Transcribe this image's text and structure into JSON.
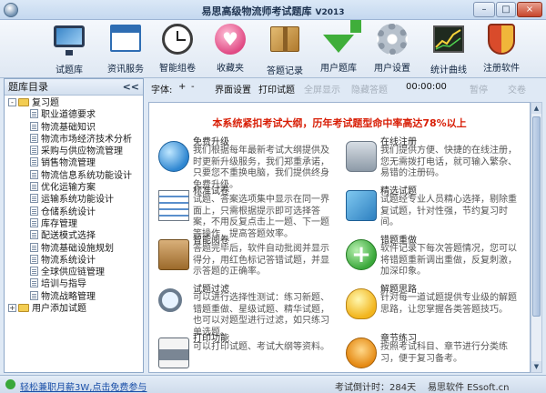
{
  "window": {
    "title": "易思高级物流师考试题库",
    "version": "V2013",
    "minimize": "–",
    "maximize": "□",
    "close": "×"
  },
  "toolbar": [
    {
      "label": "试题库",
      "icon": "monitor-icon"
    },
    {
      "label": "资讯服务",
      "icon": "webpage-icon"
    },
    {
      "label": "智能组卷",
      "icon": "clock-icon"
    },
    {
      "label": "收藏夹",
      "icon": "heart-icon"
    },
    {
      "label": "答题记录",
      "icon": "box-icon"
    },
    {
      "label": "用户题库",
      "icon": "download-arrow-icon"
    },
    {
      "label": "用户设置",
      "icon": "gear-icon"
    },
    {
      "label": "统计曲线",
      "icon": "line-chart-icon"
    },
    {
      "label": "注册软件",
      "icon": "shield-icon"
    }
  ],
  "sidebar": {
    "title": "题库目录",
    "collapse": "<<",
    "root": {
      "toggle": "-",
      "label": "复习题"
    },
    "items": [
      "职业道德要求",
      "物流基础知识",
      "物流市场经济技术分析",
      "采购与供应物流管理",
      "销售物流管理",
      "物流信息系统功能设计",
      "优化运输方案",
      "运输系统功能设计",
      "仓储系统设计",
      "库存管理",
      "配送模式选择",
      "物流基础设施规划",
      "物流系统设计",
      "全球供应链管理",
      "培训与指导",
      "物流战略管理"
    ],
    "user_root": {
      "toggle": "+",
      "label": "用户添加试题"
    }
  },
  "subbar": {
    "font_label": "字体:",
    "font_plus": "+",
    "font_minus": "-",
    "interface_settings": "界面设置",
    "print_questions": "打印试题",
    "fullscreen": "全屏显示",
    "hide_answer": "隐藏答题",
    "timer": "00:00:00",
    "pause": "暂停",
    "submit": "交卷"
  },
  "content": {
    "banner": "本系统紧扣考试大纲，历年考试题型命中率高达78%以上",
    "features": [
      {
        "title": "免费升级",
        "desc": "我们根据每年最新考试大纲提供及时更新升级服务，我们郑重承诺，只要您不重换电脑，我们提供终身免费升级。",
        "icon": "globe-icon"
      },
      {
        "title": "在线注册",
        "desc": "我们提供方便、快捷的在线注册，您无需拨打电话，就可输入繁杂、易错的注册码。",
        "icon": "database-icon"
      },
      {
        "title": "标准试卷",
        "desc": "试题、答案选项集中显示在同一界面上，只需根据提示即可选择答案，不用反复点击上一题、下一题等操作，提高答题效率。",
        "icon": "list-icon"
      },
      {
        "title": "精选试题",
        "desc": "试题经专业人员精心选择，剔除重复试题，针对性强，节约复习时间。",
        "icon": "return-icon"
      },
      {
        "title": "智能阅卷",
        "desc": "答题完毕后，软件自动批阅并显示得分，用红色标记答错试题，并显示答题的正确率。",
        "icon": "clipboard-icon"
      },
      {
        "title": "错题重做",
        "desc": "软件记录下每次答题情况，您可以将错题重新调出重做，反复刺激，加深印象。",
        "icon": "plus-icon"
      },
      {
        "title": "试题过滤",
        "desc": "可以进行选择性测试：练习新题、错题重做、星级试题、精华试题，也可以对题型进行过滤，如只练习单选题。",
        "icon": "magnifier-icon"
      },
      {
        "title": "解题思路",
        "desc": "针对每一道试题提供专业级的解题思路，让您掌握各类答题技巧。",
        "icon": "bulb-icon"
      },
      {
        "title": "打印功能",
        "desc": "可以打印试题、考试大纲等资料。",
        "icon": "printer-icon"
      },
      {
        "title": "章节练习",
        "desc": "按照考试科目、章节进行分类练习，便于复习备考。",
        "icon": "tree-icon"
      }
    ]
  },
  "statusbar": {
    "link": "轻松兼职月薪3W,点击免费参与",
    "exam_countdown": "考试倒计时：284天",
    "company": "易思软件 ESsoft.cn"
  }
}
